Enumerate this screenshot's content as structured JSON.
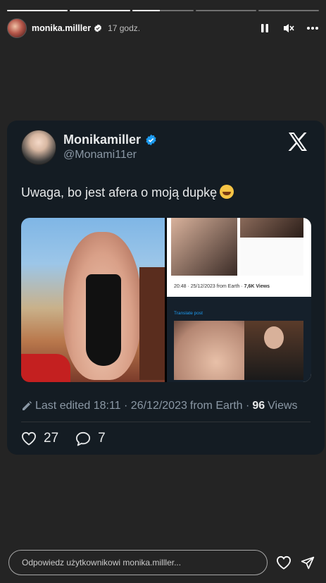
{
  "story": {
    "segments": [
      1,
      1,
      0.45,
      0,
      0
    ]
  },
  "header": {
    "username": "monika.milller",
    "time_ago": "17 godz."
  },
  "tweet": {
    "name": "Monikamiller",
    "handle": "@Monami11er",
    "text": "Uwaga, bo jest afera o moją dupkę",
    "media_caption": {
      "timestamp": "20:48 · 25/12/2023 from Earth · ",
      "views": "7,6K Views",
      "translate": "Translate post"
    },
    "edited_label": "Last edited 18:11 · 26/12/2023",
    "from": "from Earth ·",
    "views_count": "96",
    "views_label": "Views",
    "likes": "27",
    "replies": "7"
  },
  "reply": {
    "placeholder": "Odpowiedz użytkownikowi monika.milller..."
  },
  "colors": {
    "background": "#242424",
    "card": "#141c23",
    "verified": "#1d9bf0",
    "muted": "#8b98a5"
  },
  "icons": [
    "pause-icon",
    "mute-icon",
    "more-icon",
    "x-logo-icon",
    "verified-icon",
    "pencil-icon",
    "heart-icon",
    "reply-icon",
    "send-icon"
  ]
}
